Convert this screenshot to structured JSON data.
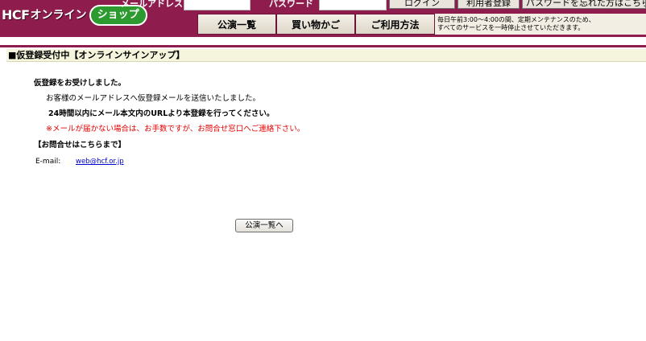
{
  "header": {
    "logo": {
      "brand": "HCF",
      "online": "オンライン",
      "shop": "ショップ"
    },
    "email_label": "メールアドレス",
    "password_label": "パスワード",
    "login_button": "ログイン",
    "register_button": "利用者登録",
    "forgot_button": "パスワードを忘れた方はこちら",
    "nav": {
      "performances": "公演一覧",
      "cart": "買い物かご",
      "guide": "ご利用方法"
    },
    "maintenance": {
      "line1": "毎日午前3:00〜4:00の間、定期メンテナンスのため、",
      "line2": "すべてのサービスを一時停止させていただきます。"
    }
  },
  "section": {
    "title": "■仮登録受付中【オンラインサインアップ】"
  },
  "message": {
    "received": "仮登録をお受けしました。",
    "sent": "お客様のメールアドレスへ仮登録メールを送信いたしました。",
    "instruction": "24時間以内にメール本文内のURLより本登録を行ってください。",
    "warning": "※メールが届かない場合は、お手数ですが、お問合せ窓口へご連絡下さい。",
    "contact_heading": "【お問合せはこちらまで】",
    "email_label": "E-mail:",
    "email_value": "web@hcf.or.jp"
  },
  "back_button": "公演一覧へ",
  "colors": {
    "header_bg": "#8e1d4e",
    "section_bg": "#f5f4dc",
    "warning": "#e60000",
    "link": "#0000cc",
    "shop_badge": "#2d9a2f"
  }
}
